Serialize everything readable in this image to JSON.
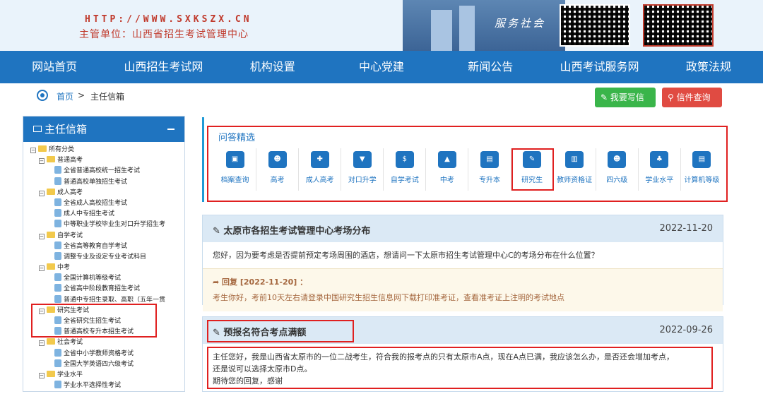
{
  "banner": {
    "url": "HTTP://WWW.SXKSZX.CN",
    "org": "主管单位：山西省招生考试管理中心",
    "service": "服务社会"
  },
  "nav": [
    "网站首页",
    "山西招生考试网",
    "机构设置",
    "中心党建",
    "新闻公告",
    "山西考试服务网",
    "政策法规"
  ],
  "breadcrumb": {
    "home": "首页",
    "sep": ">",
    "current": "主任信箱"
  },
  "buttons": {
    "write": "我要写信",
    "query": "信件查询"
  },
  "sidebar": {
    "title": "主任信箱",
    "tree": [
      {
        "level": 1,
        "type": "root",
        "label": "所有分类"
      },
      {
        "level": 2,
        "type": "folder",
        "label": "普通高考"
      },
      {
        "level": 3,
        "type": "leaf",
        "label": "全省普通高校统一招生考试"
      },
      {
        "level": 3,
        "type": "leaf",
        "label": "普通高校单独招生考试"
      },
      {
        "level": 2,
        "type": "folder",
        "label": "成人高考"
      },
      {
        "level": 3,
        "type": "leaf",
        "label": "全省成人高校招生考试"
      },
      {
        "level": 3,
        "type": "leaf",
        "label": "成人中专招生考试"
      },
      {
        "level": 3,
        "type": "leaf",
        "label": "中等职业学校毕业生对口升学招生考"
      },
      {
        "level": 2,
        "type": "folder",
        "label": "自学考试"
      },
      {
        "level": 3,
        "type": "leaf",
        "label": "全省高等教育自学考试"
      },
      {
        "level": 3,
        "type": "leaf",
        "label": "调整专业及设定专业考试科目"
      },
      {
        "level": 2,
        "type": "folder",
        "label": "中考"
      },
      {
        "level": 3,
        "type": "leaf",
        "label": "全国计算机等级考试"
      },
      {
        "level": 3,
        "type": "leaf",
        "label": "全省高中阶段教育招生考试"
      },
      {
        "level": 3,
        "type": "leaf",
        "label": "普通中专招生录取、高职（五年一贯"
      },
      {
        "level": 2,
        "type": "folder",
        "label": "研究生考试"
      },
      {
        "level": 3,
        "type": "leaf",
        "label": "全省研究生招生考试"
      },
      {
        "level": 3,
        "type": "leaf",
        "label": "普通高校专升本招生考试"
      },
      {
        "level": 2,
        "type": "folder",
        "label": "社会考试"
      },
      {
        "level": 3,
        "type": "leaf",
        "label": "全省中小学教师资格考试"
      },
      {
        "level": 3,
        "type": "leaf",
        "label": "全国大学英语四六级考试"
      },
      {
        "level": 2,
        "type": "folder",
        "label": "学业水平"
      },
      {
        "level": 3,
        "type": "leaf",
        "label": "学业水平选择性考试"
      }
    ]
  },
  "qa": {
    "title": "问答精选",
    "items": [
      {
        "label": "档案查询",
        "icon": "briefcase-icon",
        "glyph": "▣"
      },
      {
        "label": "高考",
        "icon": "people-icon",
        "glyph": "☻"
      },
      {
        "label": "成人高考",
        "icon": "user-add-icon",
        "glyph": "✚"
      },
      {
        "label": "对口升学",
        "icon": "tie-icon",
        "glyph": "▼"
      },
      {
        "label": "自学考试",
        "icon": "money-bag-icon",
        "glyph": "$"
      },
      {
        "label": "中考",
        "icon": "graduation-cap-icon",
        "glyph": "▲"
      },
      {
        "label": "专升本",
        "icon": "presentation-icon",
        "glyph": "▤"
      },
      {
        "label": "研究生",
        "icon": "teacher-icon",
        "glyph": "✎"
      },
      {
        "label": "教师资格证",
        "icon": "building-icon",
        "glyph": "▥"
      },
      {
        "label": "四六级",
        "icon": "group-icon",
        "glyph": "☻"
      },
      {
        "label": "学业水平",
        "icon": "podium-icon",
        "glyph": "♣"
      },
      {
        "label": "计算机等级",
        "icon": "computer-icon",
        "glyph": "▤"
      }
    ]
  },
  "posts": [
    {
      "title": "太原市各招生考试管理中心考场分布",
      "date": "2022-11-20",
      "question": "您好，因为要考虑是否提前预定考场周围的酒店，想请问一下太原市招生考试管理中心C的考场分布在什么位置？",
      "reply_head": "回复 [2022-11-20] ：",
      "reply_body": "考生你好，考前10天左右请登录中国研究生招生信息网下载打印准考证，查看准考证上注明的考试地点"
    },
    {
      "title": "预报名符合考点满额",
      "date": "2022-09-26",
      "q1": "主任您好，我是山西省太原市的一位二战考生，符合我的报考点的只有太原市A点，现在A点已满，我应该怎么办，是否还会增加考点，",
      "q2": "还是说可以选择太原市D点。",
      "q3": "期待您的回复，感谢"
    }
  ],
  "colors": {
    "primary": "#1f74c0",
    "highlight": "#e02020",
    "write": "#3ab54a",
    "query": "#e04b42"
  }
}
